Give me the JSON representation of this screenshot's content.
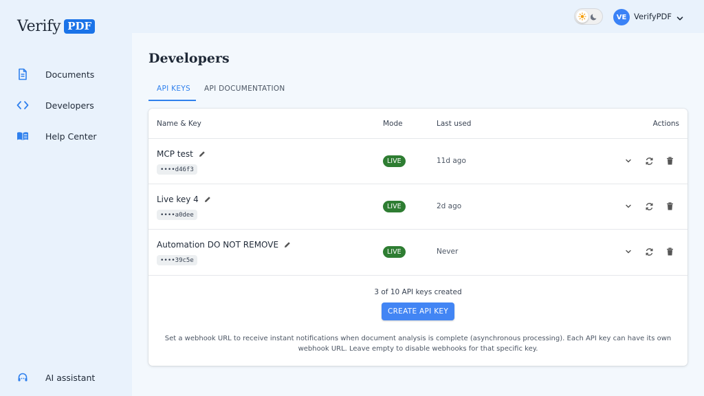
{
  "brand": {
    "name": "Verify",
    "badge": "PDF",
    "accent": "#1a73e8"
  },
  "sidebar": {
    "items": [
      {
        "label": "Documents",
        "icon": "document-icon"
      },
      {
        "label": "Developers",
        "icon": "code-icon"
      },
      {
        "label": "Help Center",
        "icon": "book-icon"
      }
    ],
    "bottom_item": {
      "label": "AI assistant",
      "icon": "headset-icon"
    }
  },
  "topbar": {
    "theme_toggle": {
      "light_icon": "sun-icon",
      "dark_icon": "moon-icon"
    },
    "user": {
      "initials": "VE",
      "name": "VerifyPDF"
    }
  },
  "page": {
    "title": "Developers",
    "tabs": [
      {
        "label": "API KEYS",
        "active": true
      },
      {
        "label": "API DOCUMENTATION",
        "active": false
      }
    ]
  },
  "table": {
    "headers": {
      "name": "Name & Key",
      "mode": "Mode",
      "last_used": "Last used",
      "actions": "Actions"
    },
    "rows": [
      {
        "name": "MCP test",
        "key": "••••d46f3",
        "mode": "LIVE",
        "last_used": "11d ago"
      },
      {
        "name": "Live key 4",
        "key": "••••a0dee",
        "mode": "LIVE",
        "last_used": "2d ago"
      },
      {
        "name": "Automation DO NOT REMOVE",
        "key": "••••39c5e",
        "mode": "LIVE",
        "last_used": "Never"
      }
    ]
  },
  "footer": {
    "count_text": "3 of 10 API keys created",
    "create_button": "CREATE API KEY",
    "note": "Set a webhook URL to receive instant notifications when document analysis is complete (asynchronous processing). Each API key can have its own webhook URL. Leave empty to disable webhooks for that specific key."
  },
  "colors": {
    "live_badge": "#2e7d32",
    "primary_button": "#4285f4",
    "tab_active": "#2f80ed"
  }
}
